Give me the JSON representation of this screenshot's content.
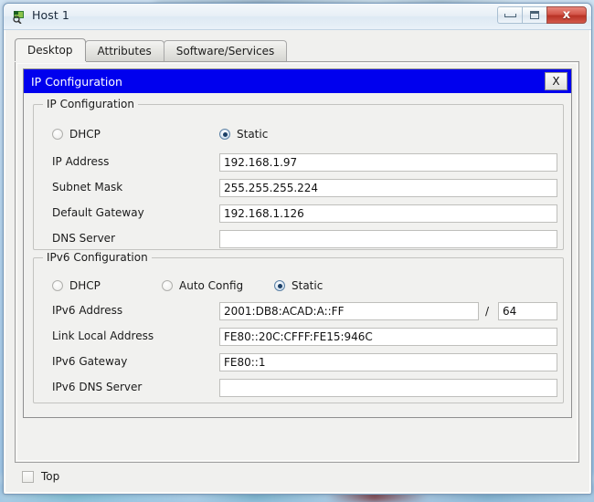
{
  "window": {
    "title": "Host 1",
    "icon": "host-device-icon",
    "buttons": {
      "minimize": "minimize-icon",
      "maximize": "maximize-icon",
      "close": "x"
    }
  },
  "tabs": [
    {
      "label": "Desktop",
      "active": true
    },
    {
      "label": "Attributes",
      "active": false
    },
    {
      "label": "Software/Services",
      "active": false
    }
  ],
  "dialog": {
    "title": "IP Configuration",
    "close_label": "X",
    "title_bg": "#0000ee",
    "ipv4": {
      "group_title": "IP Configuration",
      "modes": [
        {
          "label": "DHCP",
          "checked": false
        },
        {
          "label": "Static",
          "checked": true
        }
      ],
      "fields": [
        {
          "label": "IP Address",
          "value": "192.168.1.97"
        },
        {
          "label": "Subnet Mask",
          "value": "255.255.255.224"
        },
        {
          "label": "Default Gateway",
          "value": "192.168.1.126"
        },
        {
          "label": "DNS Server",
          "value": ""
        }
      ]
    },
    "ipv6": {
      "group_title": "IPv6 Configuration",
      "modes": [
        {
          "label": "DHCP",
          "checked": false
        },
        {
          "label": "Auto Config",
          "checked": false
        },
        {
          "label": "Static",
          "checked": true
        }
      ],
      "address": {
        "label": "IPv6 Address",
        "value": "2001:DB8:ACAD:A::FF",
        "separator": "/",
        "prefix": "64"
      },
      "fields": [
        {
          "label": "Link Local Address",
          "value": "FE80::20C:CFFF:FE15:946C"
        },
        {
          "label": "IPv6 Gateway",
          "value": "FE80::1"
        },
        {
          "label": "IPv6 DNS Server",
          "value": ""
        }
      ]
    }
  },
  "footer": {
    "top_checkbox": {
      "label": "Top",
      "checked": false
    }
  }
}
